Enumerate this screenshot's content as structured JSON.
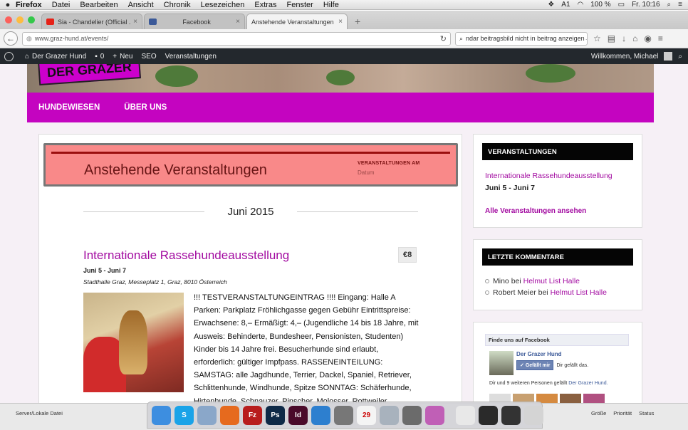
{
  "menubar": {
    "app": "Firefox",
    "items": [
      "Datei",
      "Bearbeiten",
      "Ansicht",
      "Chronik",
      "Lesezeichen",
      "Extras",
      "Fenster",
      "Hilfe"
    ],
    "status_a": "1",
    "battery": "100 %",
    "clock": "Fr. 10:16"
  },
  "tabs": [
    {
      "label": "Sia - Chandelier (Official ...",
      "close": "×",
      "icon_color": "#e62117"
    },
    {
      "label": "Facebook",
      "close": "×",
      "icon_color": "#3b5998"
    },
    {
      "label": "Anstehende Veranstaltungen | D...",
      "close": "×",
      "icon_color": "#f3f3f3"
    }
  ],
  "newtab": "+",
  "navbar": {
    "url": "www.graz-hund.at/events/",
    "search_text": "ndar beitragsbild nicht in beitrag anzeigen"
  },
  "wpbar": {
    "site": "Der Grazer Hund",
    "comments": "0",
    "new": "Neu",
    "seo": "SEO",
    "events": "Veranstaltungen",
    "greeting": "Willkommen, Michael"
  },
  "site": {
    "nav": [
      "HUNDEWIESEN",
      "ÜBER UNS"
    ]
  },
  "main": {
    "heading": "Anstehende Veranstaltungen",
    "col_header": "VERANSTALTUNGEN AM",
    "col_sub": "Datum",
    "month": "Juni 2015",
    "event": {
      "title": "Internationale Rassehundeausstellung",
      "price": "€8",
      "date": "Juni 5 - Juni 7",
      "venue": "Stadthalle Graz, Messeplatz 1, Graz, 8010 Österreich",
      "description": "!!! TESTVERANSTALTUNGEINTRAG !!!! Eingang: Halle A Parken: Parkplatz Fröhlichgasse gegen Gebühr Eintrittspreise: Erwachsene: 8,– Ermäßigt: 4,– (Jugendliche 14 bis 18 Jahre, mit Ausweis: Behinderte, Bundesheer, Pensionisten, Studenten) Kinder bis 14 Jahre frei. Besucherhunde sind erlaubt, erforderlich: gültiger Impfpass. RASSENEINTEILUNG: SAMSTAG: alle Jagdhunde, Terrier, Dackel, Spaniel, Retriever, Schlittenhunde, Windhunde, Spitze SONNTAG: Schäferhunde, Hirtenhunde, Schnauzer, Pinscher, Molosser, Rottweiler, Dobermann, Schweizer"
    }
  },
  "sidebar": {
    "events": {
      "title": "VERANSTALTUNGEN",
      "item": "Internationale Rassehundeausstellung",
      "item_date": "Juni 5 - Juni 7",
      "all": "Alle Veranstaltungen ansehen"
    },
    "comments": {
      "title": "LETZTE KOMMENTARE",
      "items": [
        {
          "author": "Mino",
          "on": "bei",
          "post": "Helmut List Halle"
        },
        {
          "author": "Robert Meier",
          "on": "bei",
          "post": "Helmut List Halle"
        }
      ]
    },
    "facebook": {
      "header": "Finde uns auf Facebook",
      "page": "Der Grazer Hund",
      "like_btn": "Gefällt mir",
      "like_text": "Dir gefällt das.",
      "friends": "Dir und 9 weiteren Personen gefällt",
      "friends_link": "Der Grazer Hund."
    }
  },
  "finder": {
    "label": "Server/Lokale Datei",
    "cols": [
      "Größe",
      "Priorität",
      "Status"
    ]
  },
  "dock": [
    {
      "name": "finder",
      "color": "#3d8ee0",
      "glyph": ""
    },
    {
      "name": "skype",
      "color": "#1aa3e8",
      "glyph": "S"
    },
    {
      "name": "mail",
      "color": "#8aa7c9",
      "glyph": ""
    },
    {
      "name": "firefox",
      "color": "#e66a1e",
      "glyph": ""
    },
    {
      "name": "filezilla",
      "color": "#b81d1d",
      "glyph": "Fz"
    },
    {
      "name": "photoshop",
      "color": "#0e2a47",
      "glyph": "Ps"
    },
    {
      "name": "indesign",
      "color": "#4a0a2a",
      "glyph": "Id"
    },
    {
      "name": "network",
      "color": "#2d7fcf",
      "glyph": ""
    },
    {
      "name": "calculator",
      "color": "#777777",
      "glyph": ""
    },
    {
      "name": "calendar",
      "color": "#f4f4f4",
      "glyph": "29"
    },
    {
      "name": "launchpad",
      "color": "#a8b2bd",
      "glyph": ""
    },
    {
      "name": "settings",
      "color": "#6b6b6b",
      "glyph": ""
    },
    {
      "name": "octopus",
      "color": "#c05fb6",
      "glyph": ""
    },
    {
      "name": "preview",
      "color": "#e8e8e8",
      "glyph": ""
    },
    {
      "name": "window1",
      "color": "#2a2a2a",
      "glyph": ""
    },
    {
      "name": "window2",
      "color": "#333333",
      "glyph": ""
    },
    {
      "name": "trash",
      "color": "#d4d4d4",
      "glyph": ""
    }
  ]
}
